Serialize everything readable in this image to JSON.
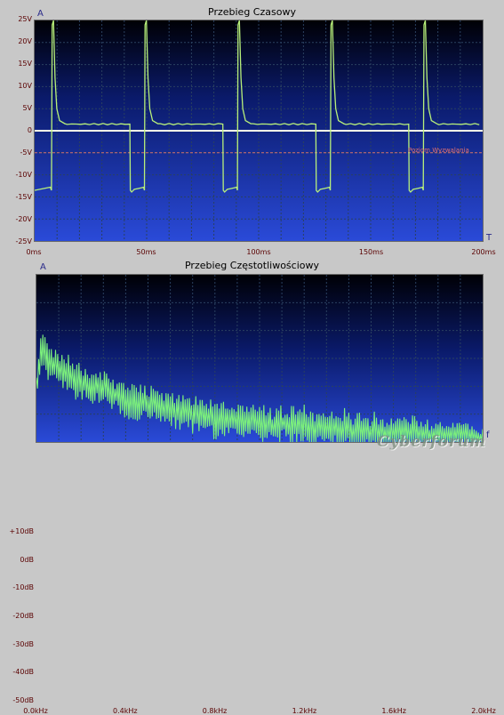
{
  "chart_data": [
    {
      "type": "line",
      "title": "Przebieg Czasowy",
      "ylabel": "A",
      "xlabel": "T",
      "xlim": [
        0,
        200
      ],
      "ylim": [
        -25,
        25
      ],
      "y_ticks": [
        "25V",
        "20V",
        "15V",
        "10V",
        "5V",
        "0",
        "-5V",
        "-10V",
        "-15V",
        "-20V",
        "-25V"
      ],
      "x_ticks": [
        "0ms",
        "50ms",
        "100ms",
        "150ms",
        "200ms"
      ],
      "grid": true,
      "trigger_level": {
        "label": "Poziom Wyzwalania",
        "value": -5
      },
      "series": [
        {
          "color": "#b8f07a",
          "period_ms": 41.5,
          "phase_ms": 7.5,
          "positive_phase_ms": 35.0,
          "peak": 25,
          "baseline_high": 1.5,
          "low_level": -13.5,
          "low_edge_peak": -12.8,
          "duty_negative": true
        },
        {
          "color": "#ffffe8",
          "constant": 0
        }
      ]
    },
    {
      "type": "line",
      "title": "Przebieg Częstotliwościowy",
      "ylabel": "A",
      "xlabel": "f",
      "xlim": [
        0,
        2.0
      ],
      "ylim": [
        -50,
        10
      ],
      "y_ticks": [
        "+10dB",
        "0dB",
        "-10dB",
        "-20dB",
        "-30dB",
        "-40dB",
        "-50dB"
      ],
      "x_ticks": [
        "0.0kHz",
        "0.4kHz",
        "0.8kHz",
        "1.2kHz",
        "1.6kHz",
        "2.0kHz"
      ],
      "grid": true,
      "series": [
        {
          "color": "#7cf07c",
          "envelope_db": [
            [
              0.0,
              -30
            ],
            [
              0.02,
              -16
            ],
            [
              0.1,
              -22
            ],
            [
              0.2,
              -27
            ],
            [
              0.4,
              -33
            ],
            [
              0.6,
              -37
            ],
            [
              0.8,
              -40
            ],
            [
              1.2,
              -43
            ],
            [
              1.6,
              -46
            ],
            [
              2.0,
              -48
            ]
          ]
        }
      ]
    }
  ],
  "watermark": "Cyberforum"
}
